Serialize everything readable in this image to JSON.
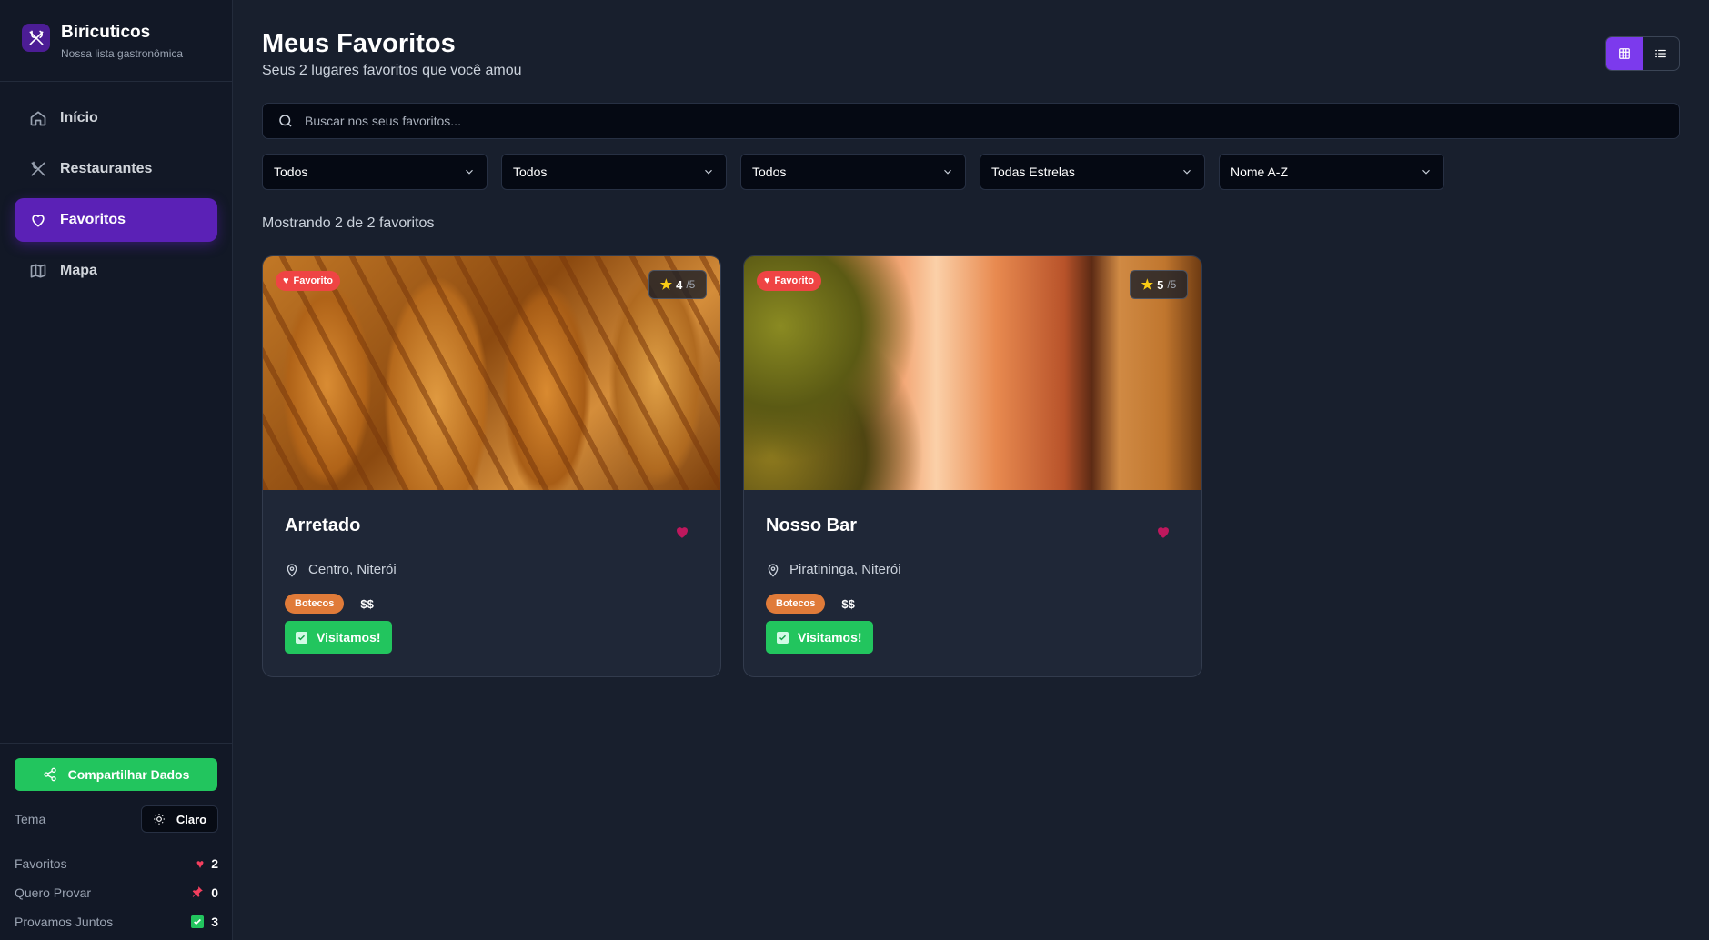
{
  "app": {
    "name": "Biricuticos",
    "tagline": "Nossa lista gastronômica"
  },
  "sidebar": {
    "items": [
      {
        "label": "Início",
        "icon": "home-icon"
      },
      {
        "label": "Restaurantes",
        "icon": "utensils-icon"
      },
      {
        "label": "Favoritos",
        "icon": "heart-icon",
        "active": true
      },
      {
        "label": "Mapa",
        "icon": "map-icon"
      }
    ],
    "share_label": "Compartilhar Dados",
    "theme_label": "Tema",
    "theme_button": "Claro",
    "stats": [
      {
        "label": "Favoritos",
        "value": "2",
        "icon": "heart-icon"
      },
      {
        "label": "Quero Provar",
        "value": "0",
        "icon": "pin-icon"
      },
      {
        "label": "Provamos Juntos",
        "value": "3",
        "icon": "check-icon"
      }
    ]
  },
  "header": {
    "title": "Meus Favoritos",
    "subtitle": "Seus 2 lugares favoritos que você amou"
  },
  "search": {
    "placeholder": "Buscar nos seus favoritos...",
    "value": ""
  },
  "filters": [
    "Todos",
    "Todos",
    "Todos",
    "Todas Estrelas",
    "Nome A-Z"
  ],
  "results_text": "Mostrando 2 de 2 favoritos",
  "cards": [
    {
      "name": "Arretado",
      "location": "Centro, Niterói",
      "category": "Botecos",
      "price": "$$",
      "rating": "4",
      "rating_max": "/5",
      "badge": "Favorito",
      "visited_label": "Visitamos!",
      "image": "breaded-sticks"
    },
    {
      "name": "Nosso Bar",
      "location": "Piratininga, Niterói",
      "category": "Botecos",
      "price": "$$",
      "rating": "5",
      "rating_max": "/5",
      "badge": "Favorito",
      "visited_label": "Visitamos!",
      "image": "beer-glass"
    }
  ],
  "colors": {
    "accent": "#5b21b6",
    "success": "#22c55e",
    "tag": "#e07b39",
    "favorite": "#ef4444"
  }
}
